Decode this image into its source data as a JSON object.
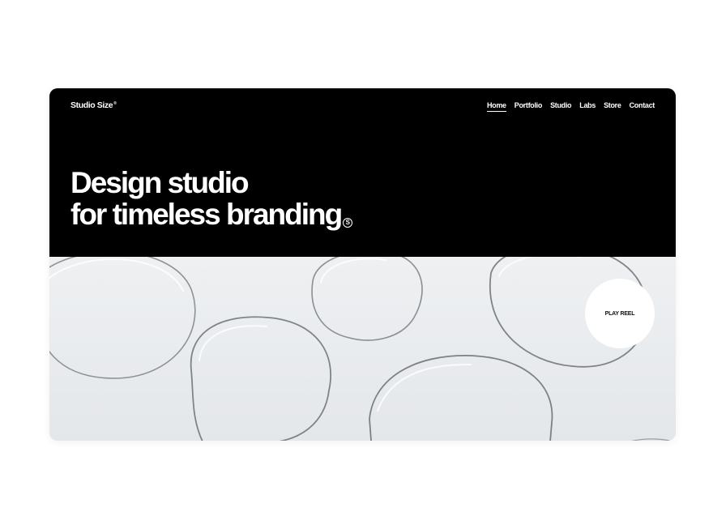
{
  "header": {
    "logo": "Studio Size",
    "logo_mark": "®"
  },
  "nav": {
    "items": [
      {
        "label": "Home",
        "active": true
      },
      {
        "label": "Portfolio",
        "active": false
      },
      {
        "label": "Studio",
        "active": false
      },
      {
        "label": "Labs",
        "active": false
      },
      {
        "label": "Store",
        "active": false
      },
      {
        "label": "Contact",
        "active": false
      }
    ]
  },
  "hero": {
    "line1": "Design studio",
    "line2": "for timeless branding",
    "mark": "S"
  },
  "cta": {
    "play_reel": "PLAY REEL"
  },
  "colors": {
    "header_bg": "#000000",
    "header_text": "#ffffff",
    "image_bg": "#e9ecee"
  }
}
